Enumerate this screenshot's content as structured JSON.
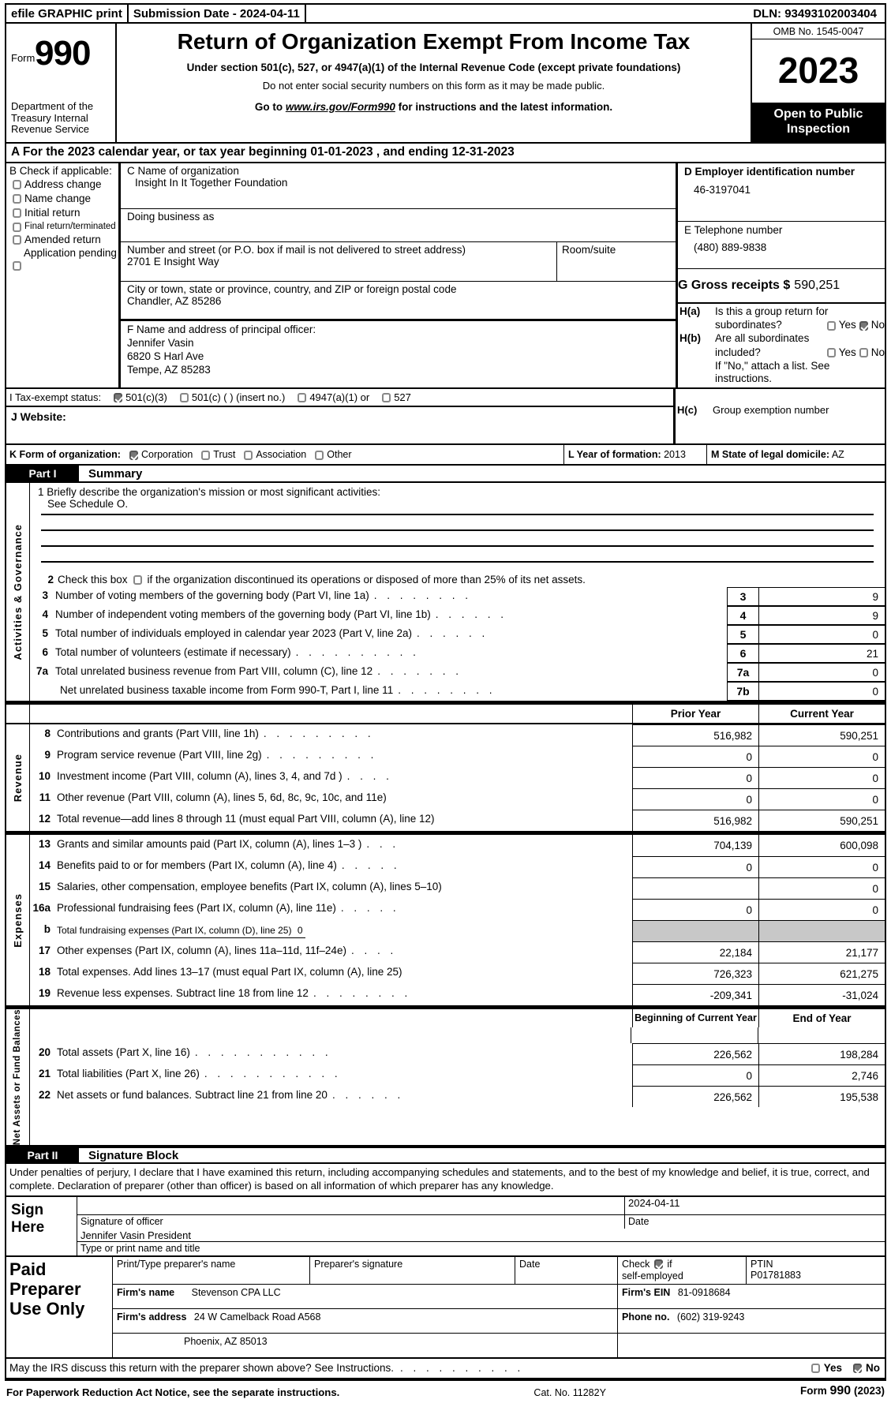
{
  "efile": {
    "print_label": "efile GRAPHIC print",
    "submission": "Submission Date - 2024-04-11",
    "dln": "DLN: 93493102003404"
  },
  "masthead": {
    "form_word": "Form",
    "form_number": "990",
    "title": "Return of Organization Exempt From Income Tax",
    "subtitle1": "Under section 501(c), 527, or 4947(a)(1) of the Internal Revenue Code (except private foundations)",
    "subtitle2": "Do not enter social security numbers on this form as it may be made public.",
    "subtitle3_pre": "Go to ",
    "subtitle3_link": "www.irs.gov/Form990",
    "subtitle3_post": " for instructions and the latest information.",
    "department": "Department of the Treasury Internal Revenue Service",
    "omb": "OMB No. 1545-0047",
    "year": "2023",
    "open_to_public": "Open to Public Inspection"
  },
  "section_a": "A For the 2023 calendar year, or tax year beginning 01-01-2023   , and ending 12-31-2023",
  "section_b": {
    "label": "B  Check if applicable:",
    "options": [
      {
        "label": "Address change",
        "checked": false
      },
      {
        "label": "Name change",
        "checked": false
      },
      {
        "label": "Initial return",
        "checked": false
      },
      {
        "label": "Final return/terminated",
        "checked": false
      },
      {
        "label": "Amended return",
        "checked": false
      },
      {
        "label": "Application pending",
        "checked": false
      }
    ]
  },
  "section_c": {
    "name_label": "C Name of organization",
    "name_value": "Insight In It Together Foundation",
    "dba_label": "Doing business as",
    "dba_value": "",
    "street_label": "Number and street (or P.O. box if mail is not delivered to street address)",
    "street_value": "2701 E Insight Way",
    "room_label": "Room/suite",
    "room_value": "",
    "city_label": "City or town, state or province, country, and ZIP or foreign postal code",
    "city_value": "Chandler, AZ  85286"
  },
  "section_f": {
    "label": "F  Name and address of principal officer:",
    "line1": "Jennifer Vasin",
    "line2": "6820 S Harl Ave",
    "line3": "Tempe, AZ  85283"
  },
  "section_d": {
    "label": "D Employer identification number",
    "value": "46-3197041"
  },
  "section_e": {
    "label": "E Telephone number",
    "value": "(480) 889-9838"
  },
  "section_g": {
    "label": "G Gross receipts $",
    "value": "590,251"
  },
  "section_h": {
    "ha_tag": "H(a)",
    "ha_text_1": "Is this a group return for",
    "ha_text_2": "subordinates?",
    "ha_yes": "Yes",
    "ha_no": "No",
    "ha_yes_checked": false,
    "ha_no_checked": true,
    "hb_tag": "H(b)",
    "hb_text_1": "Are all subordinates",
    "hb_text_2": "included?",
    "hb_yes": "Yes",
    "hb_no": "No",
    "hb_yes_checked": false,
    "hb_no_checked": false,
    "hb_note": "If \"No,\" attach a list. See instructions.",
    "hc_tag": "H(c)",
    "hc_text": "Group exemption number"
  },
  "section_i": {
    "label": "I   Tax-exempt status:",
    "options": [
      {
        "label": "501(c)(3)",
        "checked": true
      },
      {
        "label": "501(c) (   ) (insert no.)",
        "checked": false
      },
      {
        "label": "4947(a)(1) or",
        "checked": false
      },
      {
        "label": "527",
        "checked": false
      }
    ]
  },
  "section_j": {
    "label": "J   Website:",
    "value": ""
  },
  "section_k": {
    "label": "K Form of organization:",
    "options": [
      {
        "label": "Corporation",
        "checked": true
      },
      {
        "label": "Trust",
        "checked": false
      },
      {
        "label": "Association",
        "checked": false
      },
      {
        "label": "Other",
        "checked": false
      }
    ]
  },
  "section_l": {
    "label": "L Year of formation:",
    "value": "2013"
  },
  "section_m": {
    "label": "M State of legal domicile:",
    "value": "AZ"
  },
  "part1": {
    "bar_num": "Part I",
    "bar_title": "Summary",
    "mission_line": "1 Briefly describe the organization's mission or most significant activities:",
    "mission_value": "See Schedule O.",
    "line2": "2  Check this box",
    "line2_after": "if the organization discontinued its operations or disposed of more than 25% of its net assets.",
    "vert_activities": "Activities & Governance",
    "vert_revenue": "Revenue",
    "vert_expenses": "Expenses",
    "vert_netassets": "Net Assets or Fund Balances",
    "rows_counts": [
      {
        "num": "3",
        "text": "Number of voting members of the governing body (Part VI, line 1a)",
        "box": "3",
        "value": "9"
      },
      {
        "num": "4",
        "text": "Number of independent voting members of the governing body (Part VI, line 1b)",
        "box": "4",
        "value": "9"
      },
      {
        "num": "5",
        "text": "Total number of individuals employed in calendar year 2023 (Part V, line 2a)",
        "box": "5",
        "value": "0"
      },
      {
        "num": "6",
        "text": "Total number of volunteers (estimate if necessary)",
        "box": "6",
        "value": "21"
      },
      {
        "num": "7a",
        "text": "Total unrelated business revenue from Part VIII, column (C), line 12",
        "box": "7a",
        "value": "0"
      },
      {
        "num": "",
        "text": "Net unrelated business taxable income from Form 990-T, Part I, line 11",
        "box": "7b",
        "value": "0"
      }
    ],
    "money_header": {
      "prior": "Prior Year",
      "current": "Current Year"
    },
    "revenue_rows": [
      {
        "num": "8",
        "text": "Contributions and grants (Part VIII, line 1h)",
        "prior": "516,982",
        "current": "590,251"
      },
      {
        "num": "9",
        "text": "Program service revenue (Part VIII, line 2g)",
        "prior": "0",
        "current": "0"
      },
      {
        "num": "10",
        "text": "Investment income (Part VIII, column (A), lines 3, 4, and 7d )",
        "prior": "0",
        "current": "0"
      },
      {
        "num": "11",
        "text": "Other revenue (Part VIII, column (A), lines 5, 6d, 8c, 9c, 10c, and 11e)",
        "prior": "0",
        "current": "0"
      },
      {
        "num": "12",
        "text": "Total revenue—add lines 8 through 11 (must equal Part VIII, column (A), line 12)",
        "prior": "516,982",
        "current": "590,251"
      }
    ],
    "expense_rows": [
      {
        "num": "13",
        "text": "Grants and similar amounts paid (Part IX, column (A), lines 1–3 )",
        "prior": "704,139",
        "current": "600,098"
      },
      {
        "num": "14",
        "text": "Benefits paid to or for members (Part IX, column (A), line 4)",
        "prior": "0",
        "current": "0"
      },
      {
        "num": "15",
        "text": "Salaries, other compensation, employee benefits (Part IX, column (A), lines 5–10)",
        "prior": "",
        "current": "0"
      },
      {
        "num": "16a",
        "text": "Professional fundraising fees (Part IX, column (A), line 11e)",
        "prior": "0",
        "current": "0"
      }
    ],
    "fundraising_row": {
      "num": "b",
      "text": "Total fundraising expenses (Part IX, column (D), line 25)",
      "value": "0"
    },
    "expense_rows2": [
      {
        "num": "17",
        "text": "Other expenses (Part IX, column (A), lines 11a–11d, 11f–24e)",
        "prior": "22,184",
        "current": "21,177"
      },
      {
        "num": "18",
        "text": "Total expenses. Add lines 13–17 (must equal Part IX, column (A), line 25)",
        "prior": "726,323",
        "current": "621,275"
      },
      {
        "num": "19",
        "text": "Revenue less expenses. Subtract line 18 from line 12",
        "prior": "-209,341",
        "current": "-31,024"
      }
    ],
    "balance_header": {
      "begin": "Beginning of Current Year",
      "end": "End of Year"
    },
    "balance_rows": [
      {
        "num": "20",
        "text": "Total assets (Part X, line 16)",
        "begin": "226,562",
        "end": "198,284"
      },
      {
        "num": "21",
        "text": "Total liabilities (Part X, line 26)",
        "begin": "0",
        "end": "2,746"
      },
      {
        "num": "22",
        "text": "Net assets or fund balances. Subtract line 21 from line 20",
        "begin": "226,562",
        "end": "195,538"
      }
    ]
  },
  "part2": {
    "bar_num": "Part II",
    "bar_title": "Signature Block",
    "perjury": "Under penalties of perjury, I declare that I have examined this return, including accompanying schedules and statements, and to the best of my knowledge and belief, it is true, correct, and complete. Declaration of preparer (other than officer) is based on all information of which preparer has any knowledge.",
    "sign_here": "Sign Here",
    "signature_of_officer": "Signature of officer",
    "date_label": "Date",
    "date_value": "2024-04-11",
    "officer_name_title": "Jennifer Vasin  President",
    "type_name_title": "Type or print name and title"
  },
  "preparer": {
    "title": "Paid Preparer Use Only",
    "h_print_name": "Print/Type preparer's name",
    "h_signature": "Preparer's signature",
    "h_date": "Date",
    "h_check": "Check",
    "h_check_if": "if",
    "h_self_employed": "self-employed",
    "h_check_checked": true,
    "h_ptin": "PTIN",
    "ptin_value": "P01781883",
    "firm_name_label": "Firm's name",
    "firm_name_value": "Stevenson CPA LLC",
    "firm_ein_label": "Firm's EIN",
    "firm_ein_value": "81-0918684",
    "firm_address_label": "Firm's address",
    "firm_address_value": "24 W Camelback Road A568",
    "firm_city_value": "Phoenix, AZ  85013",
    "phone_label": "Phone no.",
    "phone_value": "(602) 319-9243"
  },
  "footer": {
    "irs_question": "May the IRS discuss this return with the preparer shown above? See Instructions.",
    "yes": "Yes",
    "no": "No",
    "yes_checked": false,
    "no_checked": true,
    "paperwork": "For Paperwork Reduction Act Notice, see the separate instructions.",
    "cat": "Cat. No. 11282Y",
    "form_footer_pre": "Form ",
    "form_footer_num": "990",
    "form_footer_post": " (2023)"
  }
}
